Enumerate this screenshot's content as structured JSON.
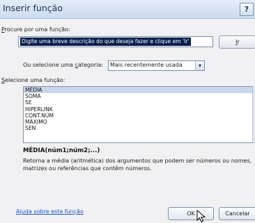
{
  "dialog": {
    "title": "Inserir função",
    "help_label": "?"
  },
  "search": {
    "label_prefix": "",
    "label_access_key": "P",
    "label_rest": "rocure por uma função:",
    "value": "Digite uma breve descrição do que deseja fazer e clique em 'Ir'",
    "go_label_access": "I",
    "go_label_rest": "r"
  },
  "category": {
    "label_prefix": "Ou selecione uma ",
    "label_access_key": "c",
    "label_rest": "ategoria:",
    "value": "Mais recentemente usada",
    "arrow": "▾"
  },
  "functions": {
    "label_prefix": "",
    "label_access_key": "S",
    "label_rest": "elecione uma função:",
    "items": [
      "MÉDIA",
      "SOMA",
      "SE",
      "HIPERLINK",
      "CONT.NÚM",
      "MÁXIMO",
      "SEN"
    ],
    "selected_index": 0,
    "syntax": "MÉDIA(núm1;núm2;...)",
    "description": "Retorna a média (aritmética) dos argumentos que podem ser números ou nomes, matrizes ou referências que contêm números."
  },
  "footer": {
    "help_link_prefix": "A",
    "help_link_access_key": "j",
    "help_link_rest": "uda sobre esta função",
    "ok_label": "OK",
    "cancel_label": "Cancelar"
  },
  "colors": {
    "title_bar": "#cddcf0",
    "selection": "#c9d5e8",
    "input_highlight": "#0b1f4f",
    "link": "#1a54c8"
  },
  "icons": {
    "cursor": "mouse-pointer-icon",
    "dropdown": "chevron-down-icon"
  }
}
